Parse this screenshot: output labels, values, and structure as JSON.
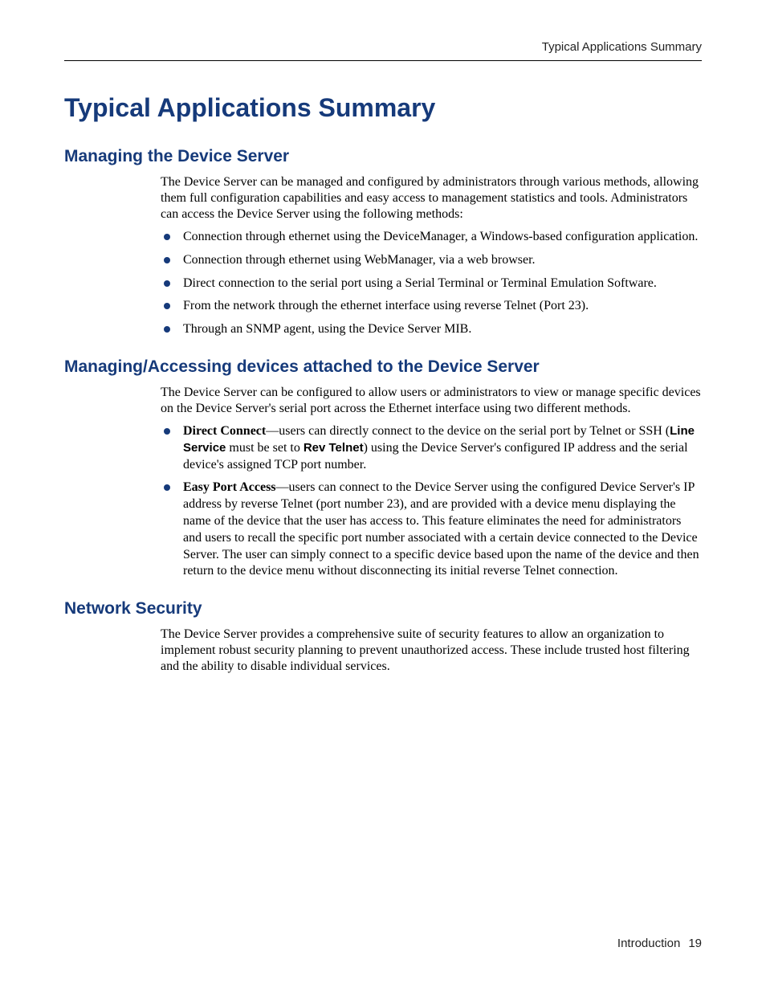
{
  "header": {
    "running_title": "Typical Applications Summary"
  },
  "title": "Typical Applications Summary",
  "sections": [
    {
      "heading": "Managing the Device Server",
      "intro": "The Device Server can be managed and configured by administrators through various methods, allowing them full configuration capabilities and easy access to management statistics and tools. Administrators can access the Device Server using the following methods:",
      "bullets": [
        {
          "text": "Connection through ethernet using the DeviceManager, a Windows-based configuration application."
        },
        {
          "text": "Connection through ethernet using WebManager, via a web browser."
        },
        {
          "text": "Direct connection to the serial port using a Serial Terminal or Terminal Emulation Software."
        },
        {
          "text": "From the network through the ethernet interface using reverse Telnet (Port 23)."
        },
        {
          "text": "Through an SNMP agent, using the Device Server MIB."
        }
      ]
    },
    {
      "heading": "Managing/Accessing devices attached to the Device Server",
      "intro": "The Device Server can be configured to allow users or administrators to view or manage specific devices on the Device Server's serial port across the Ethernet interface using two different methods.",
      "bullets": [
        {
          "lead_bold": "Direct Connect",
          "text_before_paren": "—users can directly connect to the device on the serial port by Telnet or SSH (",
          "sans_bold_1": "Line Service",
          "mid": " must be set to ",
          "sans_bold_2": "Rev Telnet",
          "text_after_paren": ") using the Device Server's configured IP address and the serial device's assigned TCP port number."
        },
        {
          "lead_bold": "Easy Port Access",
          "text": "—users can connect to the Device Server using the configured Device Server's IP address by reverse Telnet (port number 23), and are provided with a device menu displaying the name of the device that the user has access to. This feature eliminates the need for administrators and users to recall the specific port number associated with a certain device connected to the Device Server. The user can simply connect to a specific device based upon the name of the device and then return to the device menu without disconnecting its initial reverse Telnet connection."
        }
      ]
    },
    {
      "heading": "Network Security",
      "intro": "The Device Server provides a comprehensive suite of security features to allow an organization to implement robust security planning to prevent unauthorized access. These include trusted host filtering and the ability to disable individual services."
    }
  ],
  "footer": {
    "chapter": "Introduction",
    "page": "19"
  }
}
